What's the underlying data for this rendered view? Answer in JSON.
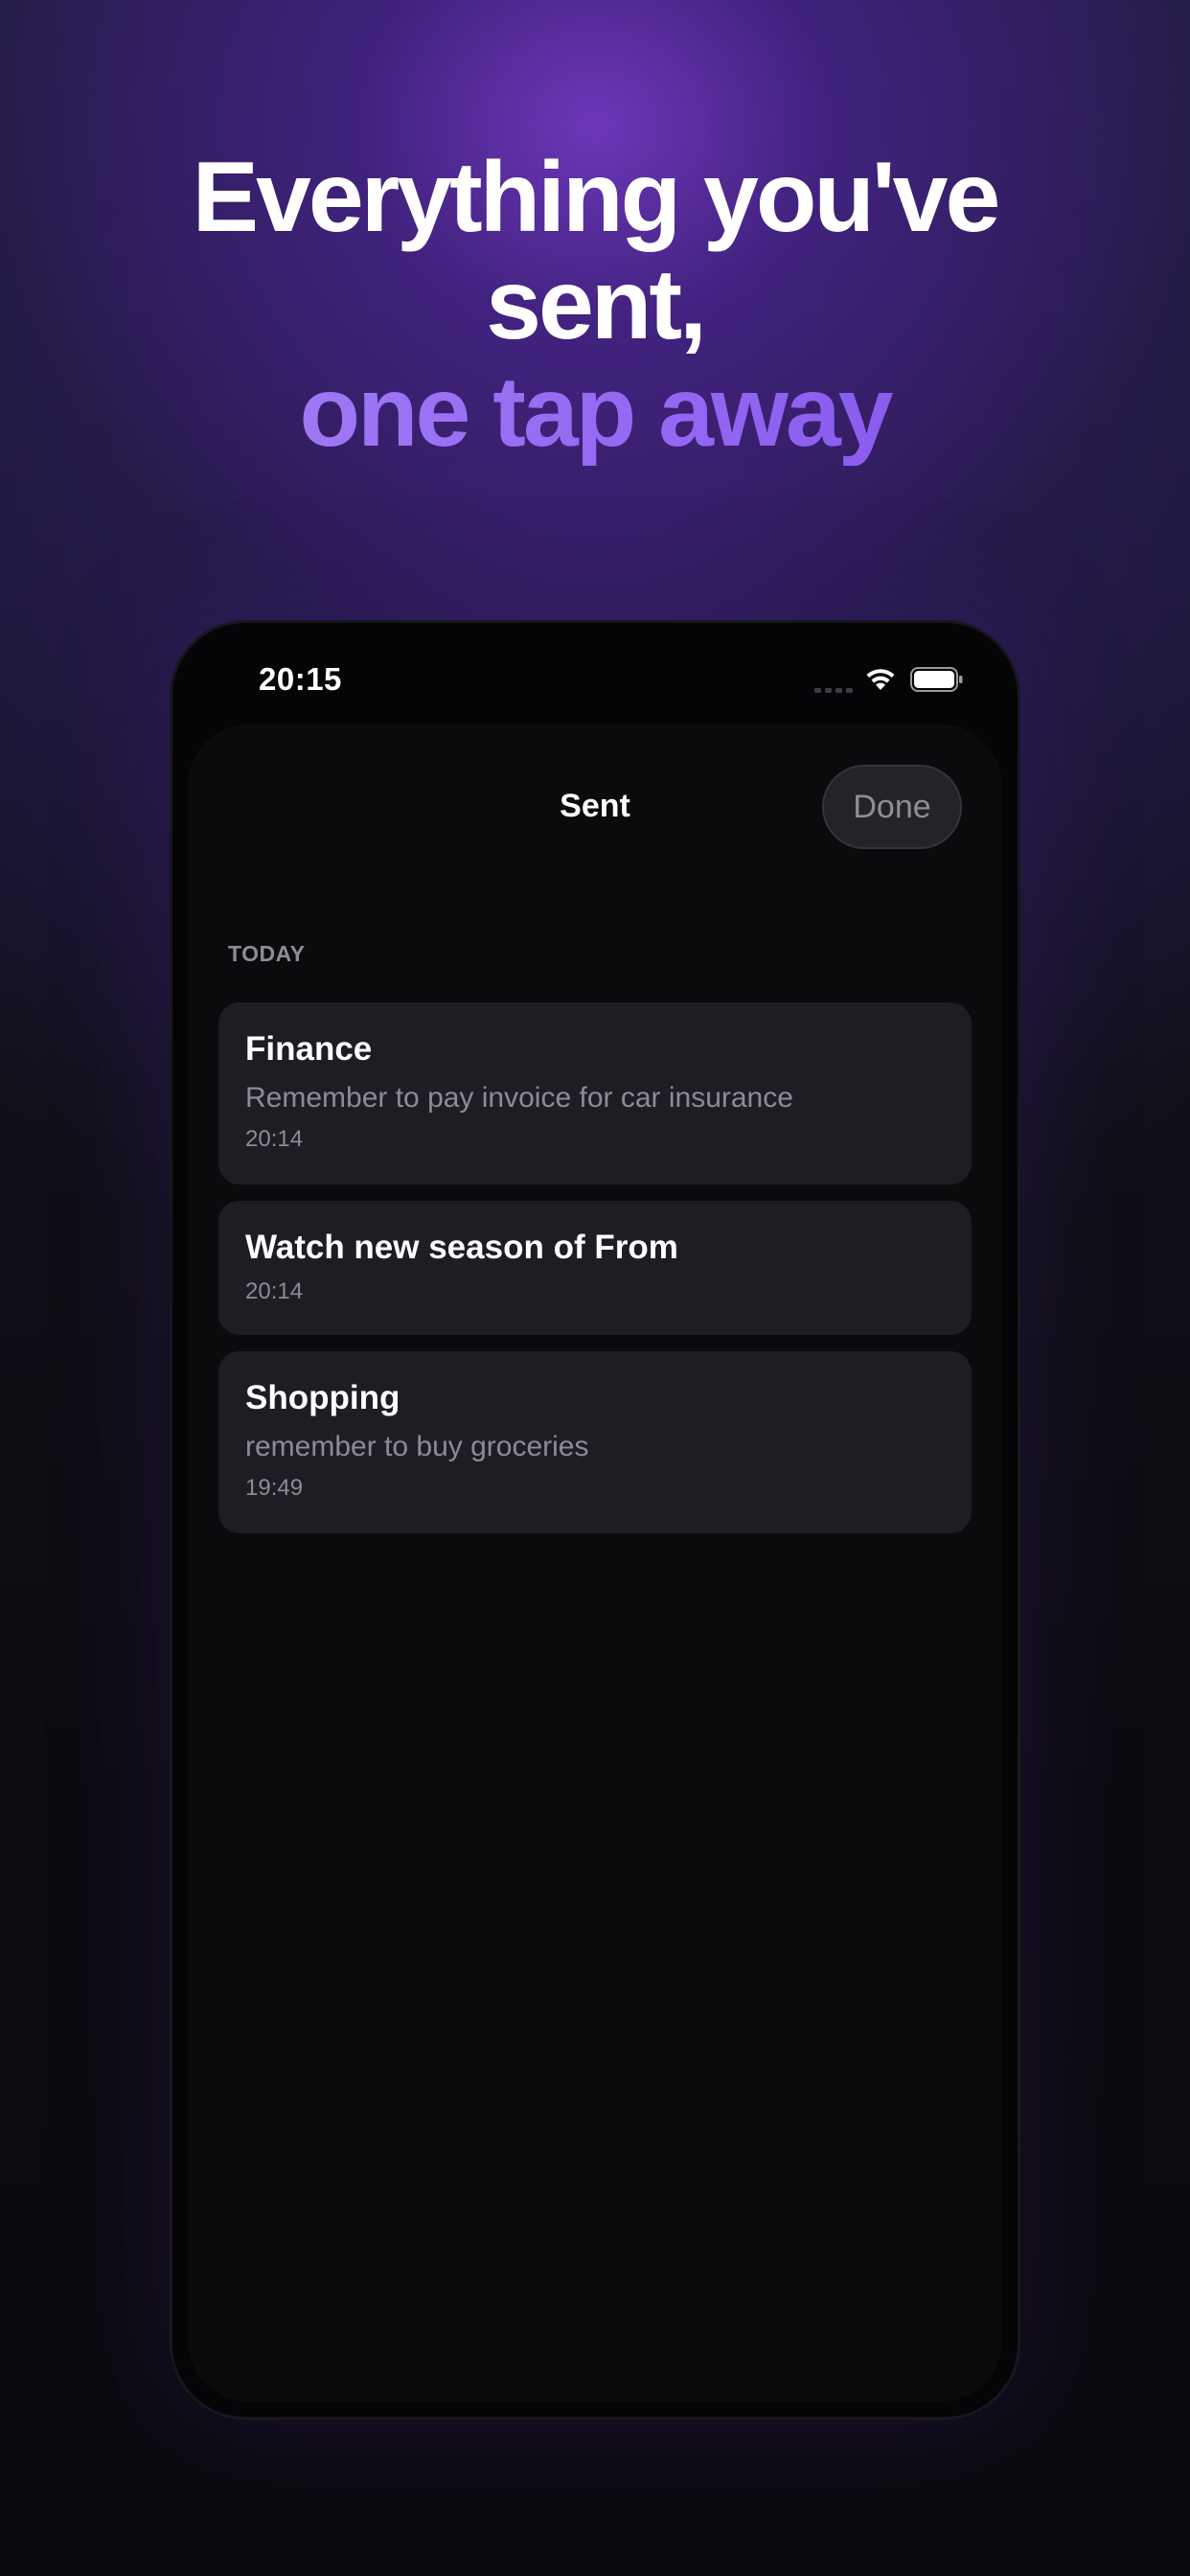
{
  "headline": {
    "line1": "Everything you've",
    "line2": "sent,",
    "line3": "one tap away"
  },
  "colors": {
    "accent_start": "#a584f6",
    "accent_end": "#7e4cea",
    "card_background": "#1d1d24",
    "sheet_background": "#0b0b0e"
  },
  "status_bar": {
    "time": "20:15",
    "icons": [
      "signal-icon",
      "wifi-icon",
      "battery-icon"
    ]
  },
  "sheet": {
    "title": "Sent",
    "done_label": "Done",
    "section_header": "TODAY",
    "items": [
      {
        "title": "Finance",
        "body": "Remember to pay invoice for car insurance",
        "time": "20:14"
      },
      {
        "title": "Watch new season of From",
        "time": "20:14"
      },
      {
        "title": "Shopping",
        "body": "remember to buy groceries",
        "time": "19:49"
      }
    ]
  }
}
